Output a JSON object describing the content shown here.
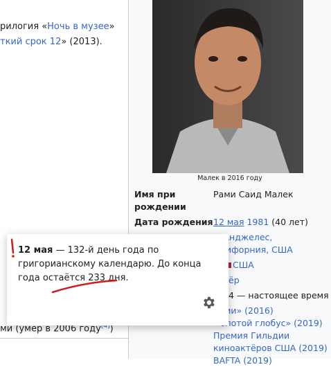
{
  "article": {
    "line1_prefix": "рилогия «",
    "line1_link": "Ночь в музее",
    "line1_suffix": "»",
    "line2_link": "ткий срок 12",
    "line2_suffix": "» (2013).",
    "bottom_text": "ми (умер в 2006 году",
    "bottom_ref": "[4]",
    "bottom_close": ")"
  },
  "infobox": {
    "caption": "Малек в 2016 году",
    "rows": [
      {
        "label": "Имя при\nрождении",
        "value": "Рами Саид Малек"
      },
      {
        "label": "Дата рождения",
        "value_link_day": "12 мая",
        "value_link_year": "1981",
        "value_suffix": " (40 лет)"
      }
    ],
    "place_line1": "-Анджелес,",
    "place_line2": "ифорния, США",
    "citizenship": "США",
    "career": "ёр",
    "active": "4 — настоящее время",
    "awards_1": "ми» (2016)",
    "awards_2": "олотой глобус» (2019)",
    "awards_3": "Премия Гильдии",
    "awards_4": "киноактёров США (2019)",
    "awards_5": "BAFTA (2019)"
  },
  "popup": {
    "bold": "12 мая",
    "text_1": " — 132-й день года по григорианскому календарю. До конца года остаётся ",
    "underlined": "233 дня",
    "text_2": ".",
    "annotation_colors": {
      "mark": "#d11a1a"
    }
  }
}
